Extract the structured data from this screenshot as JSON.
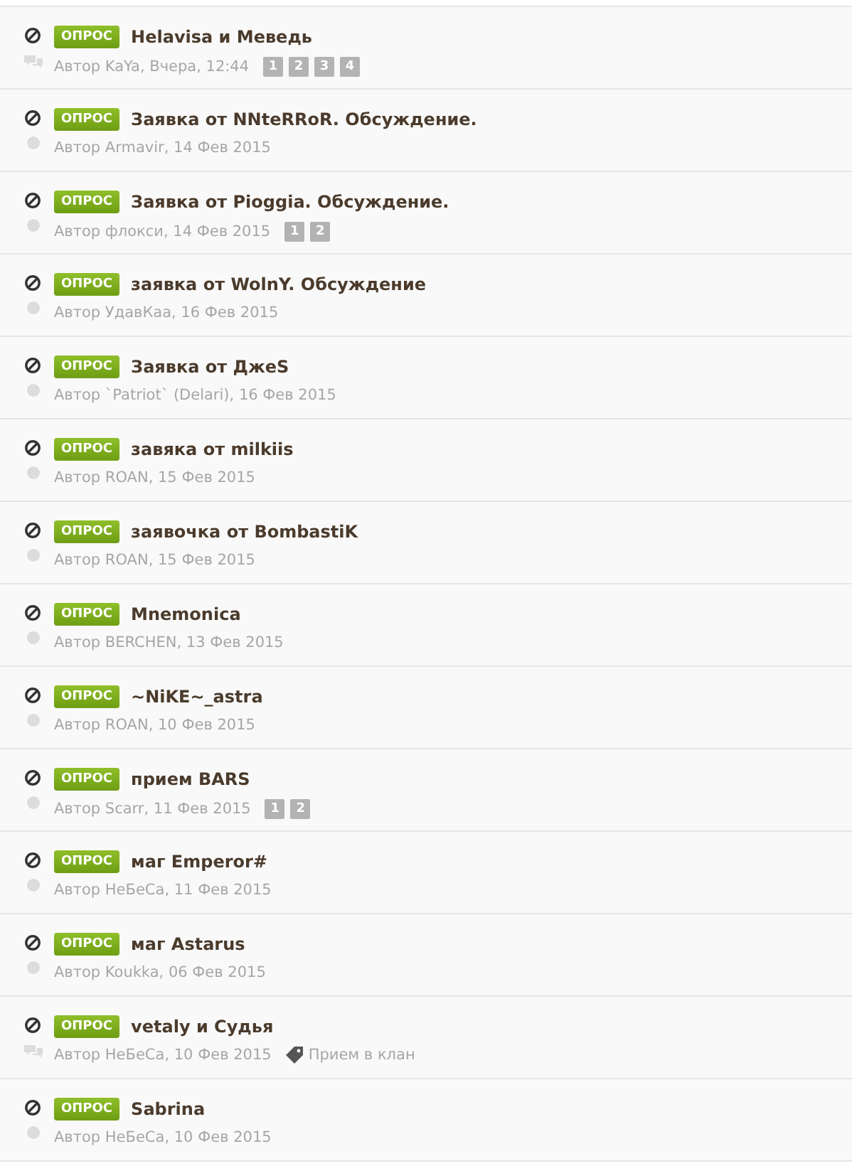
{
  "topics": [
    {
      "prefix": "ОПРОС",
      "title": "Helavisa и Меведь",
      "meta": "Автор KaYa, Вчера, 12:44",
      "kind": "replies",
      "pages": [
        "1",
        "2",
        "3",
        "4"
      ]
    },
    {
      "prefix": "ОПРОС",
      "title": "Заявка от NNteRRoR. Обсуждение.",
      "meta": "Автор Armavir, 14 Фев 2015",
      "kind": "dot"
    },
    {
      "prefix": "ОПРОС",
      "title": "Заявка от Pioggia. Обсуждение.",
      "meta": "Автор флокси, 14 Фев 2015",
      "kind": "dot",
      "pages": [
        "1",
        "2"
      ]
    },
    {
      "prefix": "ОПРОС",
      "title": "заявка от WolnY. Обсуждение",
      "meta": "Автор УдавКаа, 16 Фев 2015",
      "kind": "dot"
    },
    {
      "prefix": "ОПРОС",
      "title": "Заявка от ДжеS",
      "meta": "Автор `Patriot` (Delari), 16 Фев 2015",
      "kind": "dot"
    },
    {
      "prefix": "ОПРОС",
      "title": "завяка от milkiis",
      "meta": "Автор ROAN, 15 Фев 2015",
      "kind": "dot"
    },
    {
      "prefix": "ОПРОС",
      "title": "заявочка от BombastiK",
      "meta": "Автор ROAN, 15 Фев 2015",
      "kind": "dot"
    },
    {
      "prefix": "ОПРОС",
      "title": "Mnemonica",
      "meta": "Автор BERCHEN, 13 Фев 2015",
      "kind": "dot"
    },
    {
      "prefix": "ОПРОС",
      "title": "~NiKE~_astra",
      "meta": "Автор ROAN, 10 Фев 2015",
      "kind": "dot"
    },
    {
      "prefix": "ОПРОС",
      "title": "прием BARS",
      "meta": "Автор Scarr, 11 Фев 2015",
      "kind": "dot",
      "pages": [
        "1",
        "2"
      ]
    },
    {
      "prefix": "ОПРОС",
      "title": "маг Emperor#",
      "meta": "Автор НеБеСа, 11 Фев 2015",
      "kind": "dot"
    },
    {
      "prefix": "ОПРОС",
      "title": "маг Astarus",
      "meta": "Автор Koukka, 06 Фев 2015",
      "kind": "dot"
    },
    {
      "prefix": "ОПРОС",
      "title": "vetaly и Судья",
      "meta": "Автор НеБеСа, 10 Фев 2015",
      "kind": "replies",
      "tag": "Прием в клан"
    },
    {
      "prefix": "ОПРОС",
      "title": "Sabrina",
      "meta": "Автор НеБеСа, 10 Фев 2015",
      "kind": "dot"
    }
  ]
}
